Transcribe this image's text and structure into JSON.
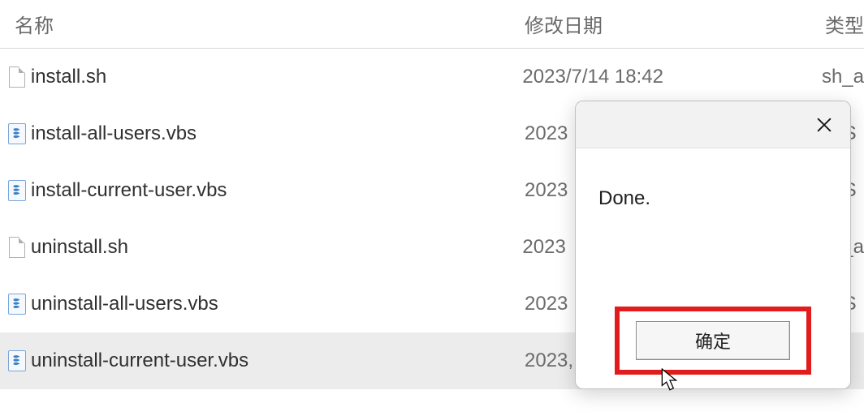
{
  "header": {
    "name": "名称",
    "date": "修改日期",
    "type": "类型"
  },
  "files": [
    {
      "name": "install.sh",
      "date": "2023/7/14 18:42",
      "type": "sh_a",
      "icon": "plain",
      "selected": false
    },
    {
      "name": "install-all-users.vbs",
      "date": "2023",
      "type": "/BS",
      "icon": "vbs",
      "selected": false
    },
    {
      "name": "install-current-user.vbs",
      "date": "2023",
      "type": "/BS",
      "icon": "vbs",
      "selected": false
    },
    {
      "name": "uninstall.sh",
      "date": "2023",
      "type": "sh_a",
      "icon": "plain",
      "selected": false
    },
    {
      "name": "uninstall-all-users.vbs",
      "date": "2023",
      "type": "/BS",
      "icon": "vbs",
      "selected": false
    },
    {
      "name": "uninstall-current-user.vbs",
      "date": "2023,",
      "type": "",
      "icon": "vbs",
      "selected": true
    }
  ],
  "dialog": {
    "message": "Done.",
    "ok_label": "确定"
  }
}
